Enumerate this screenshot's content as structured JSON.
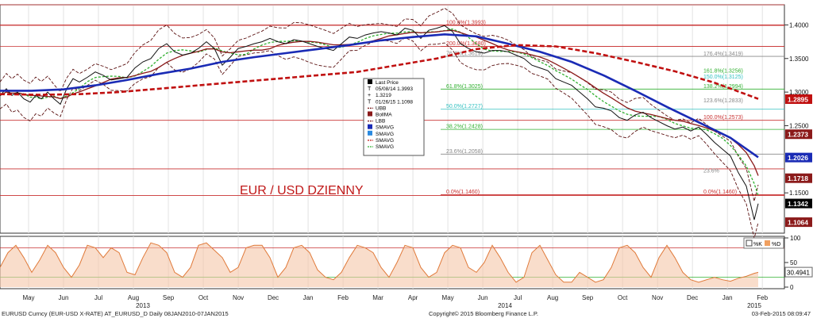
{
  "title": "EUR / USD DZIENNY",
  "footer": {
    "left": "EURUSD Curncy (EUR-USD X-RATE) AT_EURUSD_D  Daily 08JAN2010-07JAN2015",
    "center": "Copyright© 2015 Bloomberg Finance L.P.",
    "right": "03-Feb-2015 08:09:47"
  },
  "legend": {
    "items": [
      {
        "label": "Last Price",
        "color": "#000000",
        "kind": "square"
      },
      {
        "label": "05/08/14 1.3993",
        "color": "#000000",
        "kind": "T"
      },
      {
        "label": "1.3219",
        "color": "#000000",
        "kind": "plus"
      },
      {
        "label": "01/26/15 1.1098",
        "color": "#000000",
        "kind": "T"
      },
      {
        "label": "UBB",
        "color": "#7a1a1a",
        "kind": "dash"
      },
      {
        "label": "BollMA",
        "color": "#8b1a1a",
        "kind": "square"
      },
      {
        "label": "LBB",
        "color": "#7a1a1a",
        "kind": "dash"
      },
      {
        "label": "SMAVG",
        "color": "#1a2bb5",
        "kind": "square"
      },
      {
        "label": "SMAVG",
        "color": "#2a8ae0",
        "kind": "square"
      },
      {
        "label": "SMAVG",
        "color": "#c01010",
        "kind": "dash"
      },
      {
        "label": "SMAVG",
        "color": "#30b030",
        "kind": "dash"
      }
    ]
  },
  "oscillator_legend": {
    "k": "%K",
    "d": "%D"
  },
  "chart_data": [
    {
      "type": "line",
      "title": "EUR / USD DZIENNY",
      "x_ticks": [
        "May",
        "Jun",
        "Jul",
        "Aug",
        "Sep",
        "Oct",
        "Nov",
        "Dec",
        "Jan",
        "Feb",
        "Mar",
        "Apr",
        "May",
        "Jun",
        "Jul",
        "Aug",
        "Sep",
        "Oct",
        "Nov",
        "Dec",
        "Jan",
        "Feb"
      ],
      "x_year_labels": [
        "2013",
        "2014",
        "2015"
      ],
      "ylim": [
        1.09,
        1.43
      ],
      "y_ticks": [
        "1.4000",
        "1.3500",
        "1.3000",
        "1.2500",
        "1.1500"
      ],
      "y_tick_values": [
        1.4,
        1.35,
        1.3,
        1.25,
        1.15
      ],
      "price_labels": [
        {
          "text": "1.2895",
          "value": 1.2895,
          "bg": "#c01010"
        },
        {
          "text": "1.2373",
          "value": 1.2373,
          "bg": "#8b1a1a"
        },
        {
          "text": "1.2026",
          "value": 1.2026,
          "bg": "#1a2bb5"
        },
        {
          "text": "1.1718",
          "value": 1.1718,
          "bg": "#8b1a1a"
        },
        {
          "text": "1.1342",
          "value": 1.1342,
          "bg": "#000000"
        },
        {
          "text": "1.1064",
          "value": 1.1064,
          "bg": "#8b1a1a"
        }
      ],
      "horizontal_lines": [
        1.43,
        1.4,
        1.3993,
        1.368,
        1.258,
        1.1857,
        1.146
      ],
      "fib_set_1": [
        {
          "text": "100.0%(1.3993)",
          "value": 1.3993
        },
        {
          "text": "200.0%(1.3680)",
          "value": 1.368
        },
        {
          "text": "76.4%(1.3619)",
          "value": 1.3532
        },
        {
          "text": "61.8%(1.3025)",
          "value": 1.3045
        },
        {
          "text": "50.0%(1.2727)",
          "value": 1.2745
        },
        {
          "text": "38.2%(1.2428)",
          "value": 1.2445
        },
        {
          "text": "23.6%(1.2058)",
          "value": 1.2077
        },
        {
          "text": "0.0%(1.1460)",
          "value": 1.1472
        }
      ],
      "fib_set_2": [
        {
          "text": "176.4%(1.3419)",
          "value": 1.3525
        },
        {
          "text": "161.8%(1.3256)",
          "value": 1.3275
        },
        {
          "text": "150.0%(1.3125)",
          "value": 1.3185
        },
        {
          "text": "138.2%(1.2994)",
          "value": 1.3045
        },
        {
          "text": "123.6%(1.2833)",
          "value": 1.2828
        },
        {
          "text": "100.0%(1.2573)",
          "value": 1.2585
        },
        {
          "text": "23.6%",
          "value": 1.1785
        },
        {
          "text": "0.0%(1.1460)",
          "value": 1.1472
        }
      ],
      "series": [
        {
          "name": "Last Price",
          "x": [
            0,
            8,
            15,
            22,
            30,
            38,
            45,
            52,
            60,
            68,
            76,
            84,
            92,
            100,
            110,
            120,
            130,
            140,
            150,
            160,
            170,
            180,
            190,
            200,
            210,
            220,
            230,
            240,
            250,
            260,
            270,
            280,
            290,
            300,
            310,
            320,
            330,
            340,
            350,
            360,
            370,
            380,
            390,
            400,
            410,
            420,
            430,
            440,
            450,
            460,
            470,
            480,
            490,
            500,
            510,
            520,
            530,
            540,
            550,
            560,
            570,
            580,
            590,
            600,
            610,
            620,
            630,
            640,
            650,
            660,
            670,
            680,
            690,
            700,
            710,
            720,
            730,
            740,
            750,
            760,
            770,
            780,
            790,
            800,
            810,
            820,
            830,
            840,
            850,
            860,
            870,
            880,
            890,
            900,
            910,
            920,
            930,
            940,
            950,
            955
          ],
          "y": [
            1.295,
            1.305,
            1.295,
            1.3,
            1.29,
            1.285,
            1.295,
            1.29,
            1.3,
            1.29,
            1.282,
            1.305,
            1.32,
            1.315,
            1.322,
            1.33,
            1.325,
            1.318,
            1.32,
            1.322,
            1.336,
            1.345,
            1.35,
            1.365,
            1.372,
            1.36,
            1.355,
            1.358,
            1.365,
            1.375,
            1.365,
            1.34,
            1.352,
            1.365,
            1.368,
            1.372,
            1.375,
            1.38,
            1.375,
            1.372,
            1.378,
            1.376,
            1.372,
            1.368,
            1.365,
            1.362,
            1.372,
            1.382,
            1.38,
            1.385,
            1.388,
            1.39,
            1.388,
            1.385,
            1.395,
            1.392,
            1.38,
            1.392,
            1.395,
            1.399,
            1.39,
            1.372,
            1.365,
            1.36,
            1.358,
            1.362,
            1.362,
            1.36,
            1.355,
            1.35,
            1.34,
            1.336,
            1.332,
            1.32,
            1.315,
            1.31,
            1.3,
            1.29,
            1.278,
            1.276,
            1.272,
            1.262,
            1.258,
            1.266,
            1.27,
            1.262,
            1.256,
            1.25,
            1.245,
            1.248,
            1.242,
            1.248,
            1.237,
            1.225,
            1.215,
            1.205,
            1.18,
            1.16,
            1.11,
            1.134
          ]
        },
        {
          "name": "SMAVG",
          "color": "#1a2bb5",
          "x": [
            0,
            40,
            80,
            120,
            160,
            200,
            240,
            280,
            320,
            360,
            400,
            440,
            480,
            520,
            560,
            600,
            640,
            680,
            720,
            760,
            800,
            840,
            880,
            920,
            955
          ],
          "y": [
            1.302,
            1.302,
            1.304,
            1.31,
            1.318,
            1.327,
            1.335,
            1.345,
            1.352,
            1.358,
            1.364,
            1.37,
            1.377,
            1.382,
            1.386,
            1.383,
            1.372,
            1.36,
            1.345,
            1.325,
            1.302,
            1.278,
            1.255,
            1.232,
            1.203
          ]
        },
        {
          "name": "SMAVG",
          "color": "#c01010",
          "x": [
            0,
            50,
            100,
            150,
            200,
            250,
            300,
            350,
            400,
            450,
            500,
            550,
            600,
            650,
            700,
            750,
            800,
            850,
            900,
            955
          ],
          "y": [
            1.297,
            1.296,
            1.297,
            1.3,
            1.305,
            1.31,
            1.315,
            1.32,
            1.325,
            1.33,
            1.34,
            1.35,
            1.364,
            1.37,
            1.368,
            1.358,
            1.345,
            1.331,
            1.314,
            1.29
          ]
        }
      ]
    },
    {
      "type": "line",
      "title": "",
      "ylim": [
        0,
        100
      ],
      "y_ticks": [
        "100",
        "50",
        "0"
      ],
      "y_tick_values": [
        100,
        50,
        0
      ],
      "ref_lines": [
        80,
        20
      ],
      "last_value_label": "30.4941",
      "series": [
        {
          "name": "%K",
          "x": [
            0,
            10,
            20,
            30,
            40,
            50,
            60,
            70,
            80,
            90,
            100,
            110,
            120,
            130,
            140,
            150,
            160,
            170,
            180,
            190,
            200,
            210,
            220,
            230,
            240,
            250,
            260,
            270,
            280,
            290,
            300,
            310,
            320,
            330,
            340,
            350,
            360,
            370,
            380,
            390,
            400,
            410,
            420,
            430,
            440,
            450,
            460,
            470,
            480,
            490,
            500,
            510,
            520,
            530,
            540,
            550,
            560,
            570,
            580,
            590,
            600,
            610,
            620,
            630,
            640,
            650,
            660,
            670,
            680,
            690,
            700,
            710,
            720,
            730,
            740,
            750,
            760,
            770,
            780,
            790,
            800,
            810,
            820,
            830,
            840,
            850,
            860,
            870,
            880,
            890,
            900,
            910,
            920,
            930,
            940,
            950,
            955
          ],
          "y": [
            40,
            70,
            85,
            60,
            30,
            55,
            85,
            70,
            40,
            20,
            45,
            85,
            80,
            60,
            80,
            70,
            30,
            25,
            60,
            90,
            85,
            70,
            30,
            20,
            40,
            85,
            90,
            75,
            60,
            30,
            40,
            80,
            85,
            85,
            60,
            20,
            40,
            80,
            85,
            70,
            35,
            20,
            15,
            30,
            60,
            85,
            80,
            70,
            40,
            20,
            50,
            85,
            80,
            40,
            20,
            30,
            70,
            85,
            80,
            40,
            30,
            50,
            85,
            60,
            30,
            10,
            20,
            70,
            85,
            55,
            25,
            10,
            10,
            30,
            20,
            10,
            15,
            40,
            80,
            85,
            70,
            40,
            20,
            60,
            85,
            60,
            30,
            15,
            10,
            15,
            20,
            15,
            12,
            18,
            22,
            28,
            30
          ]
        }
      ]
    }
  ]
}
